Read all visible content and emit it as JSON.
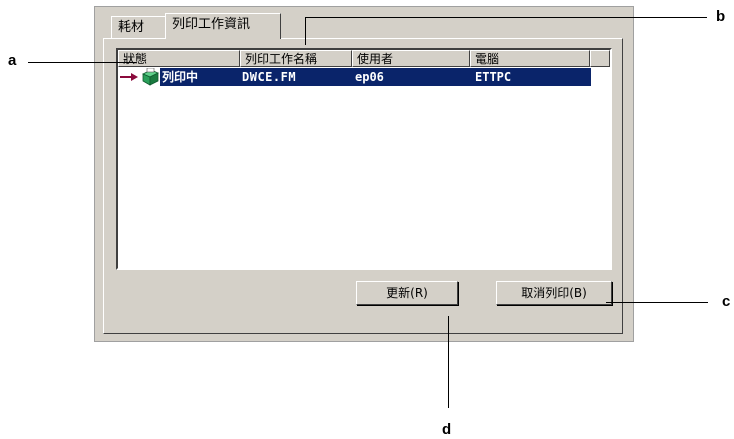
{
  "tabs": [
    {
      "label": "耗材",
      "active": false
    },
    {
      "label": "列印工作資訊",
      "active": true
    }
  ],
  "list": {
    "columns": [
      "狀態",
      "列印工作名稱",
      "使用者",
      "電腦"
    ],
    "rows": [
      {
        "status": "列印中",
        "job_name": "DWCE.FM",
        "user": "ep06",
        "computer": "ETTPC",
        "selected": true
      }
    ]
  },
  "buttons": {
    "refresh": "更新(R)",
    "cancel": "取消列印(B)"
  },
  "callouts": {
    "a": "a",
    "b": "b",
    "c": "c",
    "d": "d"
  },
  "colors": {
    "selection": "#0a246a",
    "dialog_bg": "#d4d0c8",
    "arrow": "#8b0a3c",
    "printer": "#2aa05a"
  },
  "icons": [
    "arrow-right-icon",
    "printer-icon"
  ]
}
